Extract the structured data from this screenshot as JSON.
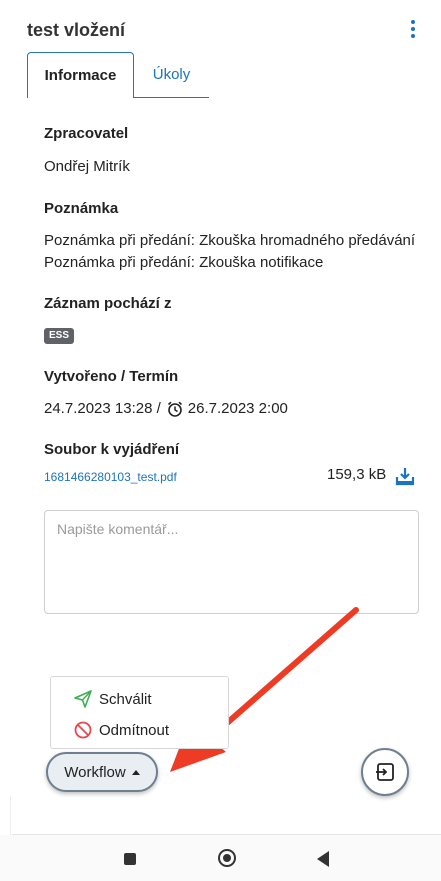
{
  "header": {
    "title": "test vložení"
  },
  "tabs": [
    {
      "label": "Informace",
      "active": true
    },
    {
      "label": "Úkoly",
      "active": false
    }
  ],
  "fields": {
    "processor_label": "Zpracovatel",
    "processor_value": "Ondřej Mitrík",
    "note_label": "Poznámka",
    "note_value": "Poznámka při předání: Zkouška hromadného předávání Poznámka při předání: Zkouška notifikace",
    "origin_label": "Záznam pochází z",
    "origin_badge": "ESS",
    "created_label": "Vytvořeno / Termín",
    "created_value": "24.7.2023 13:28 /",
    "deadline_value": "26.7.2023 2:00",
    "file_label": "Soubor k vyjádření",
    "file_name": "1681466280103_test.pdf",
    "file_size": "159,3 kB"
  },
  "comment": {
    "placeholder": "Napište komentář...",
    "value": ""
  },
  "workflow_menu": {
    "items": [
      {
        "label": "Schválit",
        "icon": "send-icon"
      },
      {
        "label": "Odmítnout",
        "icon": "block-icon"
      }
    ],
    "button_label": "Workflow"
  },
  "colors": {
    "accent": "#1e73be",
    "arrow": "#ee3b24",
    "approve": "#3cae53",
    "reject": "#e5484d",
    "badge": "#5f6368"
  }
}
